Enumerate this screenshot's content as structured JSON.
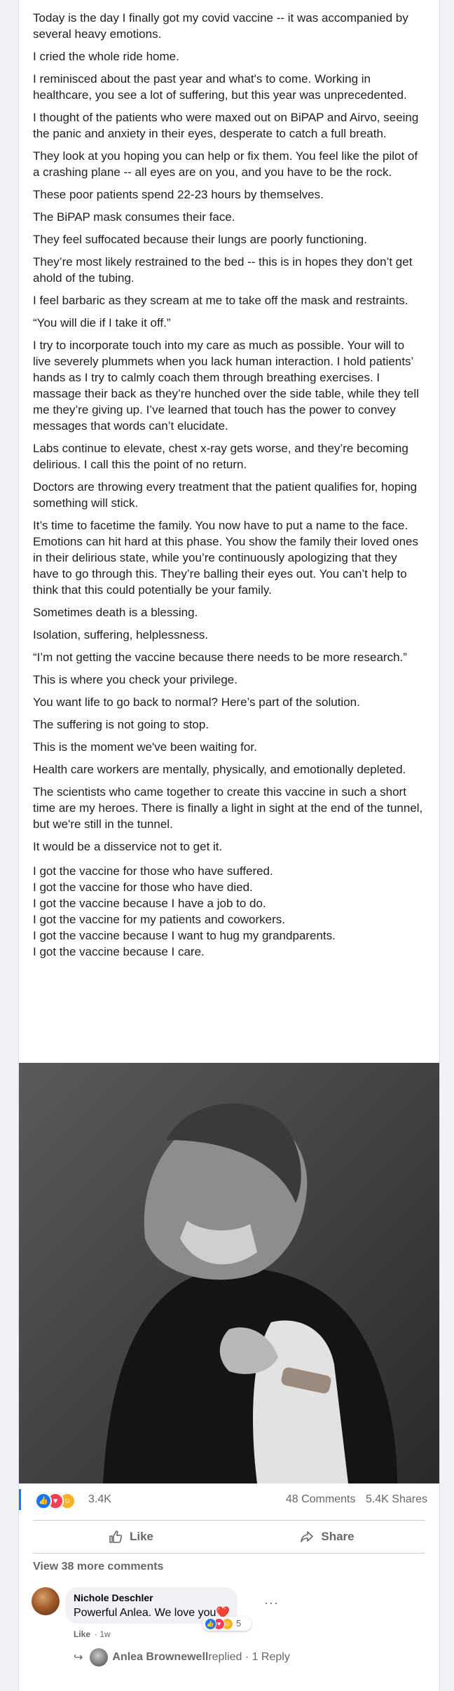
{
  "post": {
    "paragraphs": [
      "Today is the day I finally got my covid vaccine -- it was accompanied by several heavy emotions.",
      "I cried the whole ride home.",
      "I reminisced about the past year and what's to come. Working in healthcare, you see a lot of suffering, but this year was unprecedented.",
      "I thought of the patients who were maxed out on BiPAP and Airvo, seeing the panic and anxiety in their eyes, desperate to catch a full breath.",
      "They look at you hoping you can help or fix them. You feel like the pilot of a crashing plane -- all eyes are on you, and you have to be the rock.",
      "These poor patients spend 22-23 hours by themselves.",
      "The BiPAP mask consumes their face.",
      "They feel suffocated because their lungs are poorly functioning.",
      "They’re most likely restrained to the bed -- this is in hopes they don’t get ahold of the tubing.",
      "I feel barbaric as they scream at me to take off the mask and restraints.",
      "“You will die if I take it off.”",
      "I try to incorporate touch into my care as much as possible. Your will to live severely plummets when you lack human interaction. I hold patients’ hands as I try to calmly coach them through breathing exercises. I massage their back as they’re hunched over the side table, while they tell me they’re giving up. I’ve learned that touch has the power to convey messages that words can’t elucidate.",
      "Labs continue to elevate, chest x-ray gets worse, and they’re becoming delirious. I call this the point of no return.",
      "Doctors are throwing every treatment that the patient qualifies for, hoping something will stick.",
      "It’s time to facetime the family. You now have to put a name to the face. Emotions can hit hard at this phase. You show the family their loved ones in their delirious state, while you’re continuously apologizing that they have to go through this. They’re balling their eyes out. You can’t help to think that this could potentially be your family.",
      "Sometimes death is a blessing.",
      "Isolation, suffering, helplessness.",
      "“I’m not getting the vaccine because there needs to be more research.”",
      "This is where you check your privilege.",
      "You want life to go back to normal? Here’s part of the solution.",
      "The suffering is not going to stop.",
      "This is the moment we've been waiting for.",
      "Health care workers are mentally, physically, and emotionally depleted.",
      "The scientists who came together to create this vaccine in such a short time are my heroes. There is finally a light in sight at the end of the tunnel, but we're still in the tunnel.",
      "It would be a disservice not to get it."
    ],
    "closing_lines": [
      "I got the vaccine for those who have suffered.",
      "I got the vaccine for those who have died.",
      "I got the vaccine because I have a job to do.",
      "I got the vaccine for my patients and coworkers.",
      "I got the vaccine because I want to hug my grandparents.",
      "I got the vaccine because I care."
    ]
  },
  "stats": {
    "reaction_count": "3.4K",
    "comments": "48 Comments",
    "shares": "5.4K Shares",
    "reaction_icons": [
      "like-icon",
      "love-icon",
      "care-icon"
    ]
  },
  "actions": {
    "like_label": "Like",
    "share_label": "Share"
  },
  "comments": {
    "view_more": "View 38 more comments",
    "items": [
      {
        "author": "Nichole Deschler",
        "text": "Powerful Anlea. We love you",
        "emoji": "❤️",
        "reaction_count": "5",
        "like_label": "Like",
        "separator": "·",
        "time": "1w",
        "more": "···"
      }
    ],
    "reply_summary": {
      "name": "Anlea Brownewell",
      "text": " replied · 1 Reply"
    }
  },
  "colors": {
    "accent": "#1877f2",
    "love": "#f33e58",
    "care": "#f7b125",
    "muted": "#65676b"
  }
}
